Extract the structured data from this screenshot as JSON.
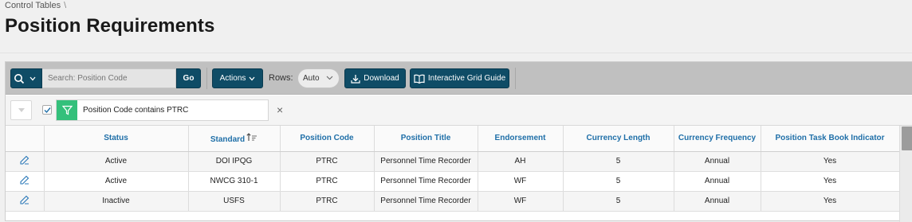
{
  "breadcrumb": {
    "items": [
      "Control Tables"
    ],
    "separator": "\\"
  },
  "page": {
    "title": "Position Requirements"
  },
  "toolbar": {
    "search_placeholder": "Search: Position Code",
    "go_label": "Go",
    "actions_label": "Actions",
    "rows_label": "Rows:",
    "rows_value": "Auto",
    "download_label": "Download",
    "guide_label": "Interactive Grid Guide"
  },
  "filter": {
    "text": "Position Code contains PTRC",
    "enabled": true,
    "remove_label": "×"
  },
  "grid": {
    "columns": [
      "Status",
      "Standard",
      "Position Code",
      "Position Title",
      "Endorsement",
      "Currency Length",
      "Currency Frequency",
      "Position Task Book Indicator"
    ],
    "sort_column": "Standard",
    "rows": [
      [
        "Active",
        "DOI IPQG",
        "PTRC",
        "Personnel Time Recorder",
        "AH",
        "5",
        "Annual",
        "Yes"
      ],
      [
        "Active",
        "NWCG 310-1",
        "PTRC",
        "Personnel Time Recorder",
        "WF",
        "5",
        "Annual",
        "Yes"
      ],
      [
        "Inactive",
        "USFS",
        "PTRC",
        "Personnel Time Recorder",
        "WF",
        "5",
        "Annual",
        "Yes"
      ]
    ]
  },
  "colors": {
    "button": "#0f4c66",
    "filter_icon": "#34c07b",
    "header_text": "#1f6fa8",
    "toolbar_bg": "#c0c0c0"
  }
}
